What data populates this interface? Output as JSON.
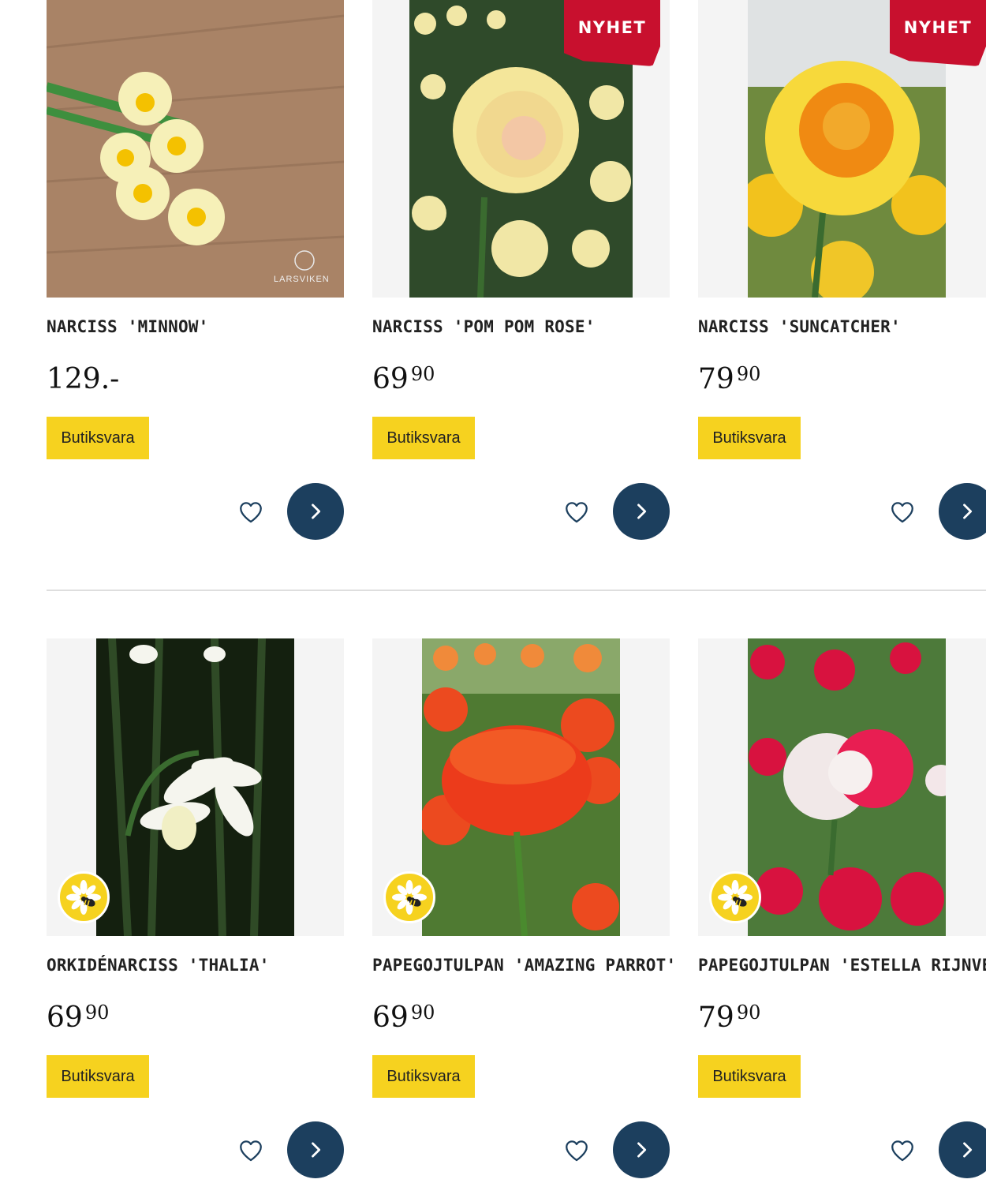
{
  "colors": {
    "accent_yellow": "#f6d21f",
    "badge_red": "#c8102e",
    "button_blue": "#1c3f5e",
    "divider": "#dedede"
  },
  "products": [
    {
      "title": "NARCISS 'MINNOW'",
      "price_main": "129.-",
      "price_dec": "",
      "tag": "Butiksvara",
      "badge": "",
      "brand_watermark": "LARSVIKEN",
      "bee_friendly": false,
      "image": "narcissus-minnow-photo",
      "icons": [
        "heart-icon",
        "chevron-right-icon"
      ]
    },
    {
      "title": "NARCISS 'POM POM ROSE'",
      "price_main": "69",
      "price_dec": "90",
      "tag": "Butiksvara",
      "badge": "NYHET",
      "bee_friendly": false,
      "image": "narcissus-pom-pom-rose-photo",
      "icons": [
        "heart-icon",
        "chevron-right-icon"
      ]
    },
    {
      "title": "NARCISS 'SUNCATCHER'",
      "price_main": "79",
      "price_dec": "90",
      "tag": "Butiksvara",
      "badge": "NYHET",
      "bee_friendly": false,
      "image": "narcissus-suncatcher-photo",
      "icons": [
        "heart-icon",
        "chevron-right-icon"
      ]
    },
    {
      "title": "ORKIDÉNARCISS 'THALIA'",
      "price_main": "69",
      "price_dec": "90",
      "tag": "Butiksvara",
      "badge": "",
      "bee_friendly": true,
      "image": "narcissus-thalia-photo",
      "icons": [
        "bee-friendly-icon",
        "heart-icon",
        "chevron-right-icon"
      ]
    },
    {
      "title": "PAPEGOJTULPAN 'AMAZING PARROT'",
      "price_main": "69",
      "price_dec": "90",
      "tag": "Butiksvara",
      "badge": "",
      "bee_friendly": true,
      "image": "tulip-amazing-parrot-photo",
      "icons": [
        "bee-friendly-icon",
        "heart-icon",
        "chevron-right-icon"
      ]
    },
    {
      "title": "PAPEGOJTULPAN 'ESTELLA RIJNVELD'",
      "price_main": "79",
      "price_dec": "90",
      "tag": "Butiksvara",
      "badge": "",
      "bee_friendly": true,
      "image": "tulip-estella-rijnveld-photo",
      "icons": [
        "bee-friendly-icon",
        "heart-icon",
        "chevron-right-icon"
      ]
    }
  ]
}
